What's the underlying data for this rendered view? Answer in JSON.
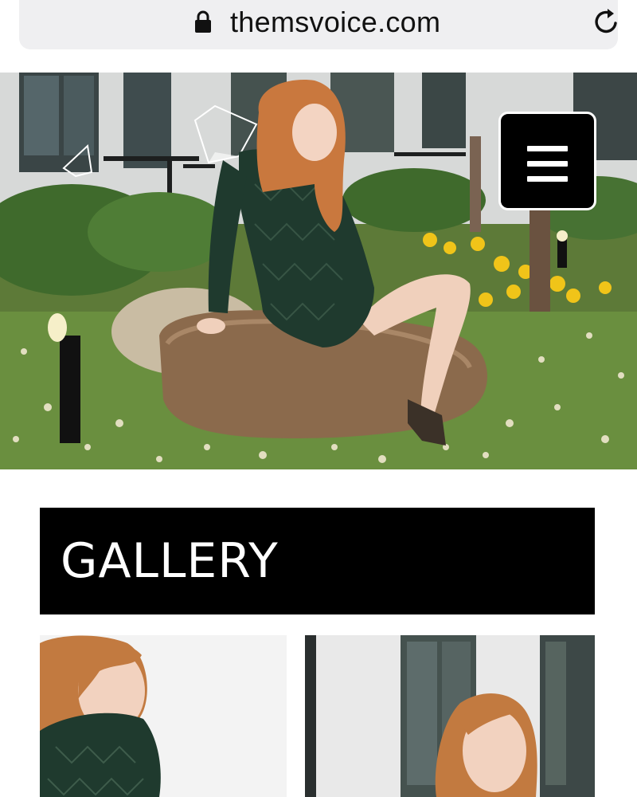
{
  "browser": {
    "url": "themsvoice.com",
    "lock_icon": "lock-icon",
    "reload_icon": "reload-icon"
  },
  "hero": {
    "menu_icon": "hamburger-menu-icon"
  },
  "gallery": {
    "title": "GALLERY",
    "thumbnails": [
      "gallery-photo-1",
      "gallery-photo-2"
    ]
  },
  "colors": {
    "bar_background": "#efeff1",
    "heading_background": "#000000",
    "heading_text": "#ffffff",
    "dress": "#1f3a2e",
    "hair": "#c9783e"
  }
}
